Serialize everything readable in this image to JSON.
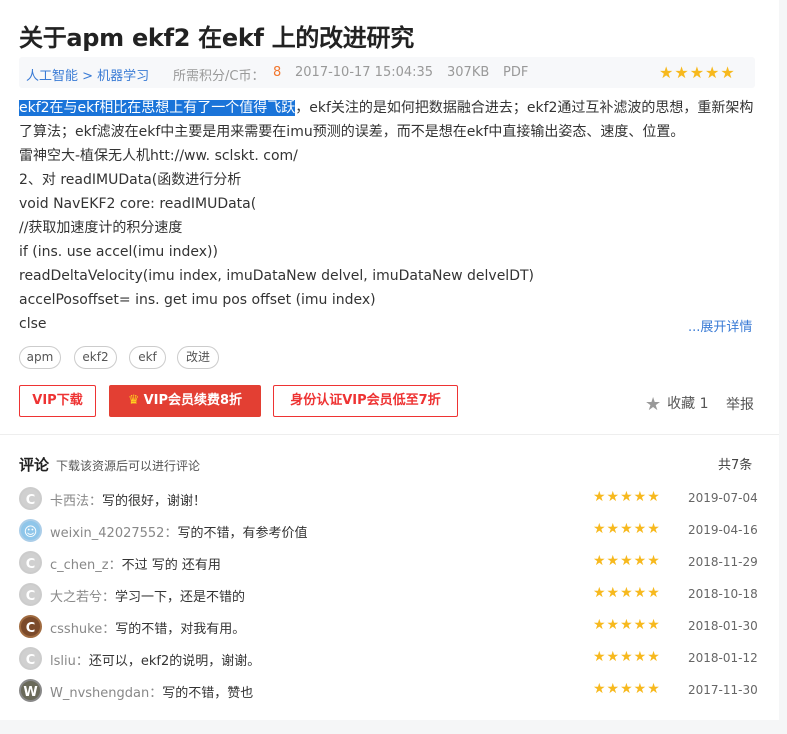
{
  "title": "关于apm ekf2 在ekf 上的改进研究",
  "meta": {
    "category": "人工智能 > 机器学习",
    "points_label": "所需积分/C币：",
    "points_value": "8",
    "datetime": "2017-10-17 15:04:35",
    "size": "307KB",
    "format": "PDF",
    "rating_stars": "★★★★★"
  },
  "content": {
    "highlight": "ekf2在与ekf相比在思想上有了一个值得飞跃",
    "line1_rest": "，ekf关注的是如何把数据融合进去；ekf2通过互补滤波的思想，重新架构",
    "line2": "了算法；ekf滤波在ekf中主要是用来需要在imu预测的误差，而不是想在ekf中直接输出姿态、速度、位置。",
    "line3": "雷神空大-植保无人机htt://ww. sclskt. com/",
    "line4": "2、对 readIMUData(函数进行分析",
    "line5": "void NavEKF2 core: readIMUData(",
    "line6": "//获取加速度计的积分速度",
    "line7": "if (ins. use accel(imu index))",
    "line8": "readDeltaVelocity(imu index, imuDataNew delvel, imuDataNew delvelDT)",
    "line9": "accelPosoffset= ins. get imu pos offset (imu index)",
    "line10": "clse",
    "more": "...展开详情"
  },
  "tags": [
    "apm",
    "ekf2",
    "ekf",
    "改进"
  ],
  "actions": {
    "vip_download": "VIP下载",
    "vip_renew": "VIP会员续费8折",
    "vip_identity": "身份认证VIP会员低至7折",
    "favorite_label": "收藏",
    "favorite_count": "1",
    "report": "举报"
  },
  "comments": {
    "title": "评论",
    "subtitle": "下载该资源后可以进行评论",
    "count": "共7条",
    "items": [
      {
        "user": "卡西法",
        "sep": "：",
        "text": "写的很好，谢谢！",
        "stars": "★★★★★",
        "date": "2019-07-04",
        "avatar": "C"
      },
      {
        "user": "weixin_42027552",
        "sep": "：",
        "text": "写的不错，有参考价值",
        "stars": "★★★★★",
        "date": "2019-04-16",
        "avatar": "☺"
      },
      {
        "user": "c_chen_z",
        "sep": "：",
        "text": "不过 写的 还有用",
        "stars": "★★★★★",
        "date": "2018-11-29",
        "avatar": "C"
      },
      {
        "user": "大之若兮",
        "sep": "：",
        "text": "学习一下，还是不错的",
        "stars": "★★★★★",
        "date": "2018-10-18",
        "avatar": "C"
      },
      {
        "user": "csshuke",
        "sep": "：",
        "text": "写的不错，对我有用。",
        "stars": "★★★★★",
        "date": "2018-01-30",
        "avatar": "C"
      },
      {
        "user": "lsliu",
        "sep": "：",
        "text": "还可以，ekf2的说明，谢谢。",
        "stars": "★★★★★",
        "date": "2018-01-12",
        "avatar": "C"
      },
      {
        "user": "W_nvshengdan",
        "sep": "：",
        "text": "写的不错，赞也",
        "stars": "★★★★★",
        "date": "2017-11-30",
        "avatar": "W"
      }
    ]
  }
}
